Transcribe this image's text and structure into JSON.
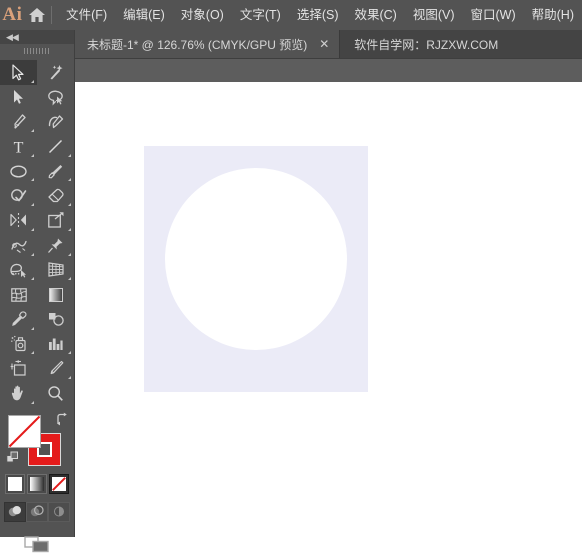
{
  "app": {
    "logo_text": "Ai",
    "home_icon": "home-icon"
  },
  "menubar": {
    "items": [
      {
        "label": "文件(F)",
        "name": "menu-file"
      },
      {
        "label": "编辑(E)",
        "name": "menu-edit"
      },
      {
        "label": "对象(O)",
        "name": "menu-object"
      },
      {
        "label": "文字(T)",
        "name": "menu-type"
      },
      {
        "label": "选择(S)",
        "name": "menu-select"
      },
      {
        "label": "效果(C)",
        "name": "menu-effect"
      },
      {
        "label": "视图(V)",
        "name": "menu-view"
      },
      {
        "label": "窗口(W)",
        "name": "menu-window"
      },
      {
        "label": "帮助(H)",
        "name": "menu-help"
      }
    ]
  },
  "tabbar": {
    "document_tab": {
      "title": "未标题-1* @ 126.76% (CMYK/GPU 预览)",
      "close_label": "✕"
    },
    "watermark": "软件自学网：RJZXW.COM"
  },
  "toolpanel": {
    "collapse_label": "◀◀",
    "tools": [
      {
        "name": "selection-tool",
        "icon": "arrow-solid-outline",
        "active": true,
        "corner": true
      },
      {
        "name": "magic-wand-tool",
        "icon": "magic-wand",
        "active": false,
        "corner": false
      },
      {
        "name": "direct-selection-tool",
        "icon": "arrow-filled",
        "active": false,
        "corner": false
      },
      {
        "name": "lasso-tool",
        "icon": "lasso",
        "active": false,
        "corner": false
      },
      {
        "name": "pen-tool",
        "icon": "pen",
        "active": false,
        "corner": true
      },
      {
        "name": "curvature-tool",
        "icon": "curvature-pen",
        "active": false,
        "corner": false
      },
      {
        "name": "type-tool",
        "icon": "type-T",
        "active": false,
        "corner": true
      },
      {
        "name": "line-segment-tool",
        "icon": "line-segment",
        "active": false,
        "corner": true
      },
      {
        "name": "ellipse-tool",
        "icon": "ellipse",
        "active": false,
        "corner": true
      },
      {
        "name": "paintbrush-tool",
        "icon": "paintbrush",
        "active": false,
        "corner": true
      },
      {
        "name": "shaper-tool",
        "icon": "shaper",
        "active": false,
        "corner": true
      },
      {
        "name": "eraser-tool",
        "icon": "eraser",
        "active": false,
        "corner": true
      },
      {
        "name": "rotate-tool",
        "icon": "reflect",
        "active": false,
        "corner": true
      },
      {
        "name": "scale-tool",
        "icon": "scale",
        "active": false,
        "corner": true
      },
      {
        "name": "width-tool",
        "icon": "warp",
        "active": false,
        "corner": true
      },
      {
        "name": "free-transform-tool",
        "icon": "pushpin",
        "active": false,
        "corner": true
      },
      {
        "name": "shape-builder-tool",
        "icon": "shape-builder",
        "active": false,
        "corner": true
      },
      {
        "name": "perspective-grid-tool",
        "icon": "perspective-grid",
        "active": false,
        "corner": true
      },
      {
        "name": "mesh-tool",
        "icon": "mesh",
        "active": false,
        "corner": false
      },
      {
        "name": "gradient-tool",
        "icon": "gradient",
        "active": false,
        "corner": false
      },
      {
        "name": "eyedropper-tool",
        "icon": "eyedropper",
        "active": false,
        "corner": true
      },
      {
        "name": "blend-tool",
        "icon": "blend",
        "active": false,
        "corner": false
      },
      {
        "name": "symbol-sprayer-tool",
        "icon": "symbol-sprayer",
        "active": false,
        "corner": true
      },
      {
        "name": "column-graph-tool",
        "icon": "bar-graph",
        "active": false,
        "corner": true
      },
      {
        "name": "artboard-tool",
        "icon": "artboard",
        "active": false,
        "corner": false
      },
      {
        "name": "slice-tool",
        "icon": "slice-knife",
        "active": false,
        "corner": true
      },
      {
        "name": "hand-tool",
        "icon": "hand",
        "active": false,
        "corner": true
      },
      {
        "name": "zoom-tool",
        "icon": "magnifier",
        "active": false,
        "corner": false
      }
    ],
    "fill_stroke": {
      "fill_name": "fill-swatch",
      "fill_color": "#ffffff",
      "fill_is_none": true,
      "stroke_name": "stroke-swatch",
      "stroke_color": "#e41b1b",
      "swap_icon": "swap-fill-stroke-icon",
      "default_icon": "default-fill-stroke-icon"
    },
    "mode_buttons": [
      {
        "name": "color-button",
        "icon": "solid-color-swatch",
        "selected": false
      },
      {
        "name": "gradient-button",
        "icon": "gradient-swatch",
        "selected": false
      },
      {
        "name": "none-button",
        "icon": "none-swatch",
        "selected": true
      }
    ],
    "draw_modes": [
      {
        "name": "draw-normal-button",
        "icon": "draw-normal-icon",
        "selected": true
      },
      {
        "name": "draw-behind-button",
        "icon": "draw-behind-icon",
        "selected": false
      },
      {
        "name": "draw-inside-button",
        "icon": "draw-inside-icon",
        "selected": false
      }
    ],
    "screen_mode": {
      "name": "change-screen-mode-button",
      "icon": "screen-mode-icon"
    }
  },
  "canvas": {
    "artboard_name": "artboard",
    "artboard_color": "#ebebf7",
    "shape_name": "white-circle-shape",
    "shape_color": "#ffffff"
  }
}
